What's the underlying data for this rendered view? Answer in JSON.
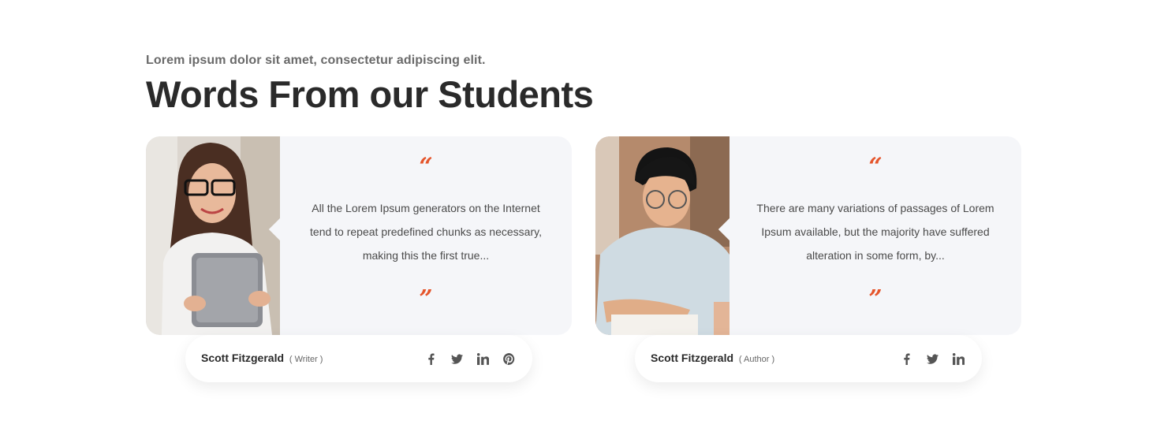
{
  "section": {
    "subtitle": "Lorem ipsum dolor sit amet, consectetur adipiscing elit.",
    "title": "Words From our Students"
  },
  "testimonials": [
    {
      "quote_open": "“",
      "quote": "All the Lorem Ipsum generators on the Internet tend to repeat predefined chunks as necessary, making this the first true...",
      "quote_close": "”",
      "name": "Scott Fitzgerald",
      "role": "( Writer )",
      "photo_icon": "student-woman-with-tablet-photo",
      "socials": [
        "facebook-icon",
        "twitter-icon",
        "linkedin-icon",
        "pinterest-icon"
      ]
    },
    {
      "quote_open": "“",
      "quote": "There are many variations of passages of Lorem Ipsum available, but the majority have suffered alteration in some form, by...",
      "quote_close": "”",
      "name": "Scott Fitzgerald",
      "role": "( Author )",
      "photo_icon": "student-man-studying-photo",
      "socials": [
        "facebook-icon",
        "twitter-icon",
        "linkedin-icon"
      ]
    }
  ],
  "colors": {
    "accent": "#e5552b",
    "card_bg": "#f5f6f9",
    "heading": "#2a2a2a"
  }
}
